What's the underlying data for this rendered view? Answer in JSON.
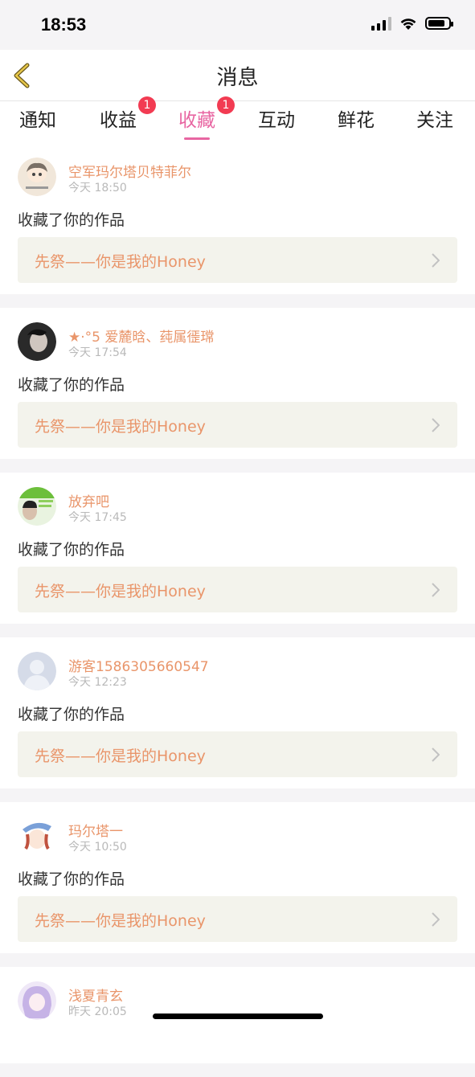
{
  "status_bar": {
    "time": "18:53"
  },
  "nav": {
    "title": "消息"
  },
  "tabs": [
    {
      "label": "通知",
      "badge": ""
    },
    {
      "label": "收益",
      "badge": "1"
    },
    {
      "label": "收藏",
      "badge": "1",
      "active": true
    },
    {
      "label": "互动",
      "badge": ""
    },
    {
      "label": "鲜花",
      "badge": ""
    },
    {
      "label": "关注",
      "badge": ""
    }
  ],
  "feed": [
    {
      "user": "空军玛尔塔贝特菲尔",
      "time": "今天 18:50",
      "action": "收藏了你的作品",
      "work": "先祭——你是我的Honey",
      "avatar_color": "#e9d9c4"
    },
    {
      "user": "★·°5 爱麓晗、莼属徰瑺",
      "time": "今天 17:54",
      "action": "收藏了你的作品",
      "work": "先祭——你是我的Honey",
      "avatar_color": "#3b3b3b"
    },
    {
      "user": "放弃吧",
      "time": "今天 17:45",
      "action": "收藏了你的作品",
      "work": "先祭——你是我的Honey",
      "avatar_color": "#6cbf3b"
    },
    {
      "user": "游客1586305660547",
      "time": "今天 12:23",
      "action": "收藏了你的作品",
      "work": "先祭——你是我的Honey",
      "avatar_color": "#c9d3e3"
    },
    {
      "user": "玛尔塔一",
      "time": "今天 10:50",
      "action": "收藏了你的作品",
      "work": "先祭——你是我的Honey",
      "avatar_color": "#e7a7a0"
    },
    {
      "user": "浅夏青玄",
      "time": "昨天 20:05",
      "action": "",
      "work": "",
      "avatar_color": "#c6b3e6"
    }
  ]
}
